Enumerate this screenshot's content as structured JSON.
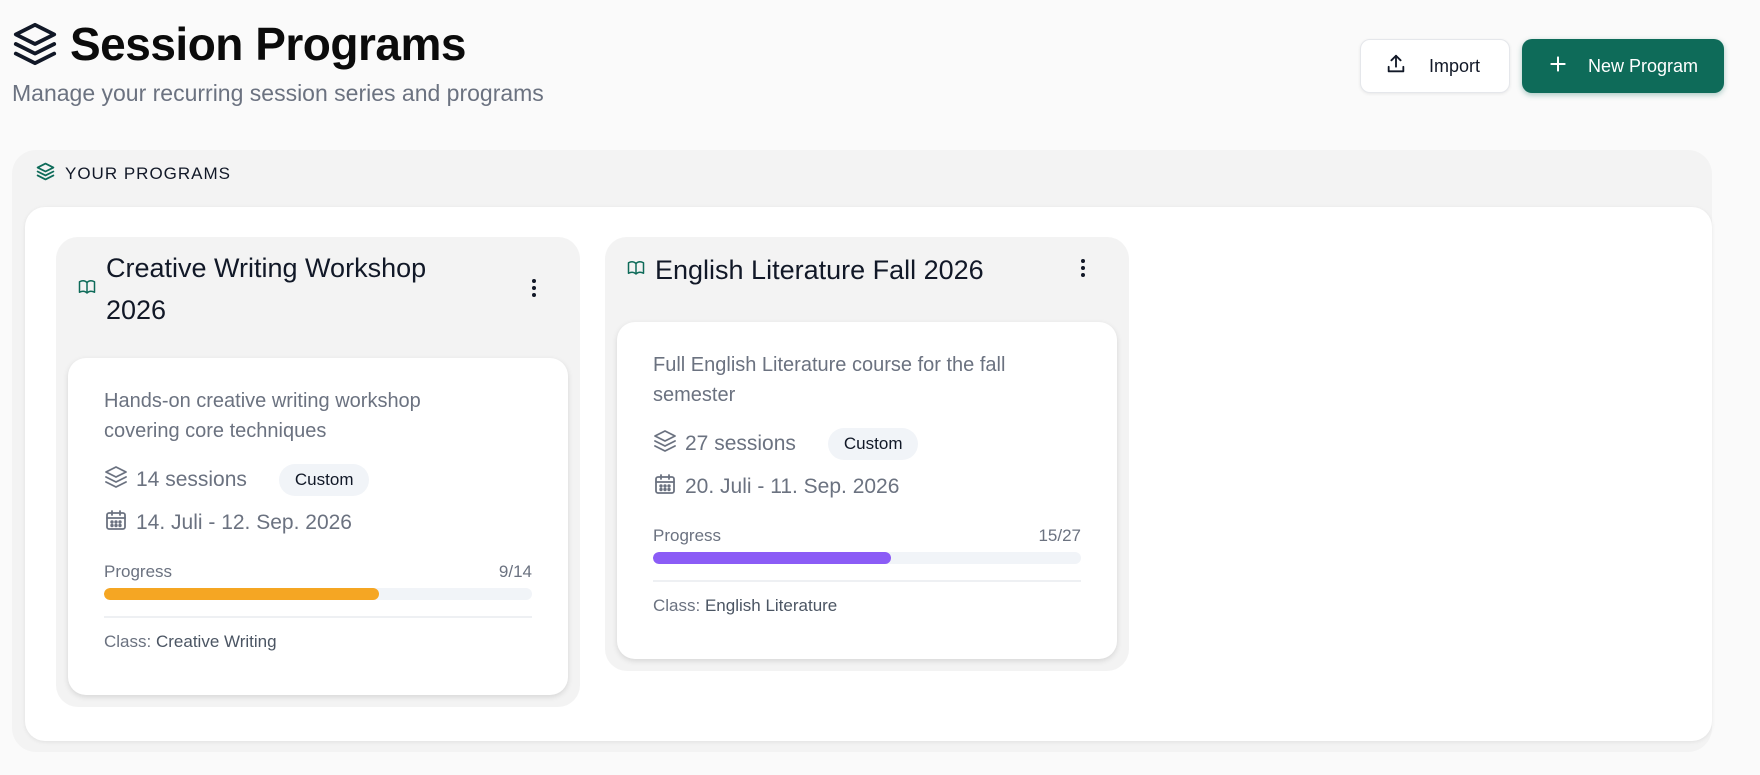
{
  "header": {
    "title": "Session Programs",
    "subtitle": "Manage your recurring session series and programs",
    "title_icon": "layers-icon"
  },
  "actions": {
    "import_label": "Import",
    "new_label": "New Program"
  },
  "section": {
    "title": "YOUR PROGRAMS"
  },
  "colors": {
    "brand": "#0e6b59",
    "progress_orange": "#f5a623",
    "progress_purple": "#8b5cf6"
  },
  "programs": [
    {
      "name_line1": "Creative Writing Workshop",
      "name_line2": "2026",
      "description_line1": "Hands-on creative writing workshop",
      "description_line2": "covering core techniques",
      "sessions": "14 sessions",
      "badge": "Custom",
      "dates": "14. Juli - 12. Sep. 2026",
      "progress_label": "Progress",
      "progress_text": "9/14",
      "progress_fraction": 0.643,
      "class_label": "Class:",
      "class_value": "Creative Writing"
    },
    {
      "name_line1": "English Literature Fall 2026",
      "description_line1": "Full English Literature course for the fall",
      "description_line2": "semester",
      "sessions": "27 sessions",
      "badge": "Custom",
      "dates": "20. Juli - 11. Sep. 2026",
      "progress_label": "Progress",
      "progress_text": "15/27",
      "progress_fraction": 0.556,
      "class_label": "Class:",
      "class_value": "English Literature"
    }
  ]
}
